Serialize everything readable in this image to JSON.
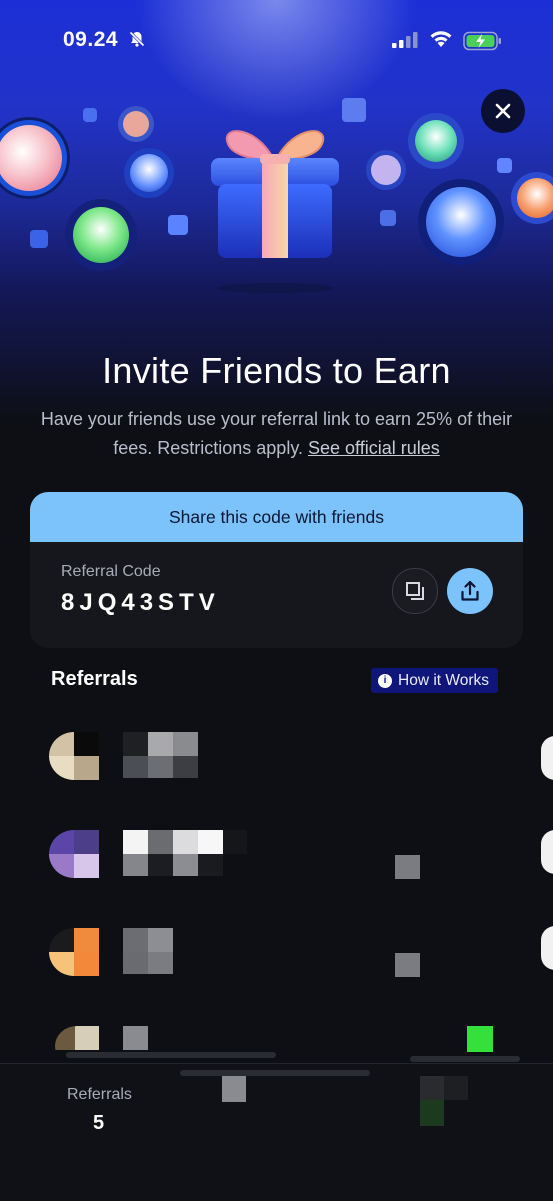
{
  "status_bar": {
    "time": "09.24"
  },
  "modal": {
    "title": "Invite Friends to Earn",
    "subtitle": "Have your friends use your referral link to earn 25% of their fees. Restrictions apply.",
    "rules_link": "See official rules"
  },
  "code_card": {
    "header": "Share this code with friends",
    "label": "Referral Code",
    "code": "8JQ43STV"
  },
  "referrals": {
    "title": "Referrals",
    "how_it_works": "How it Works"
  },
  "footer": {
    "label": "Referrals",
    "count": "5"
  },
  "colors": {
    "accent": "#7cc3fb",
    "hero_blue": "#2233c9",
    "background": "#0d0f14",
    "badge": "#10157a"
  }
}
